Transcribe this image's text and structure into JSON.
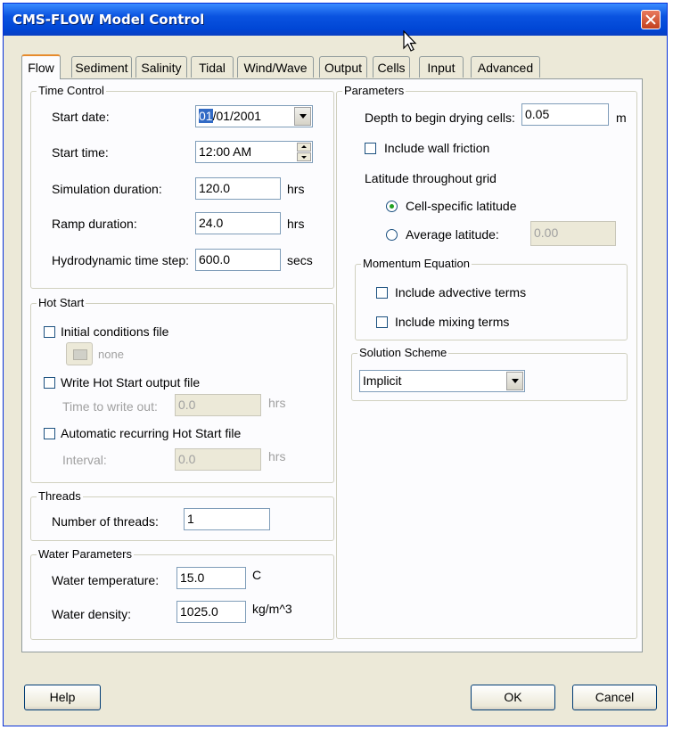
{
  "window": {
    "title": "CMS-FLOW Model Control"
  },
  "tabs": [
    "Flow",
    "Sediment",
    "Salinity",
    "Tidal",
    "Wind/Wave",
    "Output",
    "Cells",
    "Input",
    "Advanced"
  ],
  "time_control": {
    "legend": "Time Control",
    "start_date_label": "Start date:",
    "start_date_month": "01",
    "start_date_rest": "/01/2001",
    "start_time_label": "Start time:",
    "start_time_value": "12:00 AM",
    "sim_duration_label": "Simulation duration:",
    "sim_duration_value": "120.0",
    "sim_duration_unit": "hrs",
    "ramp_label": "Ramp duration:",
    "ramp_value": "24.0",
    "ramp_unit": "hrs",
    "timestep_label": "Hydrodynamic time step:",
    "timestep_value": "600.0",
    "timestep_unit": "secs"
  },
  "hot_start": {
    "legend": "Hot Start",
    "initial_label": "Initial conditions file",
    "file_none": "none",
    "write_label": "Write Hot Start output file",
    "time_write_label": "Time to write out:",
    "time_write_value": "0.0",
    "time_write_unit": "hrs",
    "auto_label": "Automatic recurring Hot Start file",
    "interval_label": "Interval:",
    "interval_value": "0.0",
    "interval_unit": "hrs"
  },
  "threads": {
    "legend": "Threads",
    "num_label": "Number of threads:",
    "num_value": "1"
  },
  "water": {
    "legend": "Water Parameters",
    "temp_label": "Water temperature:",
    "temp_value": "15.0",
    "temp_unit": "C",
    "density_label": "Water density:",
    "density_value": "1025.0",
    "density_unit": "kg/m^3"
  },
  "parameters": {
    "legend": "Parameters",
    "drying_label": "Depth to begin drying cells:",
    "drying_value": "0.05",
    "drying_unit": "m",
    "wall_friction_label": "Include wall friction",
    "latitude_heading": "Latitude throughout grid",
    "cell_lat_label": "Cell-specific latitude",
    "avg_lat_label": "Average latitude:",
    "avg_lat_value": "0.00"
  },
  "momentum": {
    "legend": "Momentum Equation",
    "advective_label": "Include advective terms",
    "mixing_label": "Include mixing terms"
  },
  "solution": {
    "legend": "Solution Scheme",
    "value": "Implicit"
  },
  "buttons": {
    "help": "Help",
    "ok": "OK",
    "cancel": "Cancel"
  },
  "colors": {
    "titlebar": "#0a53e0",
    "dialog_bg": "#ece9d8",
    "tab_accent": "#e68b2c",
    "selection": "#316ac5"
  }
}
